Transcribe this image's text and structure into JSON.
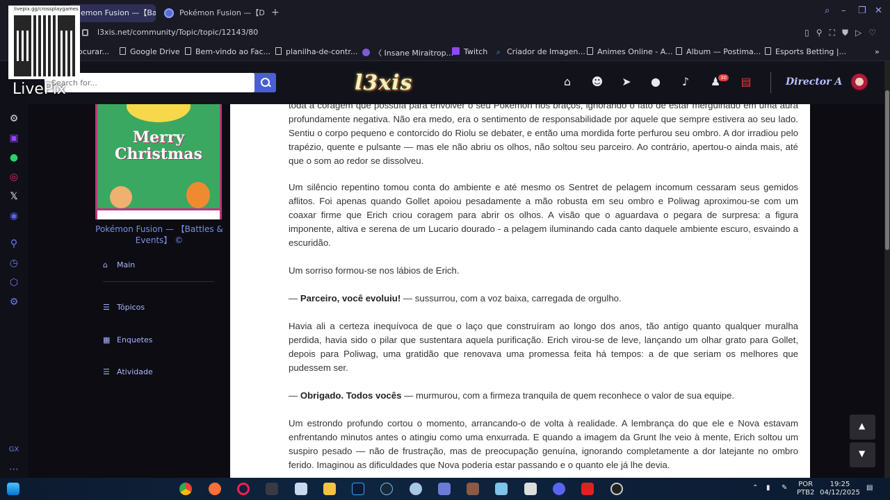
{
  "browser": {
    "tabs": [
      {
        "label": "emon Fusion —【Battle",
        "active": true
      },
      {
        "label": "Pokémon Fusion —【Data",
        "active": false
      }
    ],
    "url": "l3xis.net/community/Topic/topic/12143/80",
    "bookmarks": [
      {
        "label": "ocurar..."
      },
      {
        "label": "Google Drive"
      },
      {
        "label": "Bem-vindo ao Fac..."
      },
      {
        "label": "planilha-de-contr..."
      },
      {
        "label": "〈 Insane Miraitrop..."
      },
      {
        "label": "Twitch"
      },
      {
        "label": "Criador de Imagen..."
      },
      {
        "label": "Animes Online - A..."
      },
      {
        "label": "Album — Postima..."
      },
      {
        "label": "Esports Betting |..."
      }
    ]
  },
  "overlay": {
    "qr_caption": "livepix.gg/crossplaygames",
    "brand": "LivePix"
  },
  "site": {
    "search_placeholder": "Search for...",
    "logo": "l3xis",
    "notification_count": "30",
    "user_name": "Director A",
    "accent_color": "#4a5fd1"
  },
  "sidebar": {
    "forum_title": "Pokémon Fusion — 【Battles & Events】 ©",
    "banner_text_1": "Merry",
    "banner_text_2": "Christmas",
    "nav": [
      {
        "label": "Main"
      },
      {
        "label": "Tópicos"
      },
      {
        "label": "Enquetes"
      },
      {
        "label": "Atividade"
      }
    ]
  },
  "article": {
    "p1": "toda a coragem que possuía para envolver o seu Pokémon nos braços, ignorando o fato de estar mergulhado em uma aura profundamente negativa. Não era medo, era o sentimento de responsabilidade por aquele que sempre estivera ao seu lado. Sentiu o corpo pequeno e contorcido do Riolu se debater, e então uma mordida forte perfurou seu ombro. A dor irradiou pelo trapézio, quente e pulsante — mas ele não abriu os olhos, não soltou seu parceiro. Ao contrário, apertou-o ainda mais, até que o som ao redor se dissolveu.",
    "p2": "Um silêncio repentino tomou conta do ambiente e até mesmo os Sentret de pelagem incomum cessaram seus gemidos aflitos. Foi apenas quando Gollet apoiou pesadamente a mão robusta em seu ombro e Poliwag aproximou-se com um coaxar firme que Erich criou coragem para abrir os olhos. A visão que o aguardava o pegara de surpresa: a figura imponente, altiva e serena de um Lucario dourado - a pelagem iluminando cada canto daquele ambiente escuro, esvaindo a escuridão.",
    "p3": "Um sorriso formou-se nos lábios de Erich.",
    "p4_dash": "— ",
    "p4_bold": "Parceiro, você evoluiu!",
    "p4_rest": " — sussurrou, com a voz baixa, carregada de orgulho.",
    "p5": "Havia ali a certeza inequívoca de que o laço que construíram ao longo dos anos, tão antigo quanto qualquer muralha perdida, havia sido o pilar que sustentara aquela purificação. Erich virou-se de leve, lançando um olhar grato para Gollet, depois para Poliwag, uma gratidão que renovava uma promessa feita há tempos: a de que seriam os melhores que pudessem ser.",
    "p6_dash": "— ",
    "p6_bold": "Obrigado. Todos vocês",
    "p6_rest": " — murmurou, com a firmeza tranquila de quem reconhece o valor de sua equipe.",
    "p7": "Um estrondo profundo cortou o momento, arrancando-o de volta à realidade. A lembrança do que ele e Nova estavam enfrentando minutos antes o atingiu como uma enxurrada. E quando a imagem da Grunt lhe veio à mente, Erich soltou um suspiro pesado — não de frustração, mas de preocupação genuína, ignorando completamente a dor latejante no ombro ferido. Imaginou as dificuldades que Nova poderia estar passando e o quanto ele já lhe devia."
  },
  "taskbar": {
    "lang_1": "POR",
    "lang_2": "PTB2",
    "time": "19:25",
    "date": "04/12/2025"
  }
}
